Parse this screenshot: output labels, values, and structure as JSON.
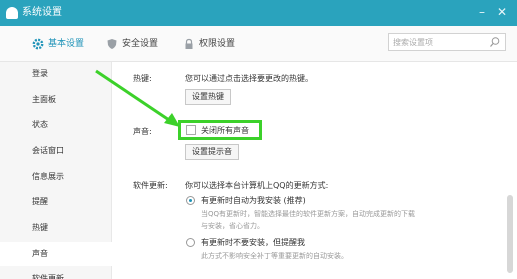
{
  "window": {
    "title": "系统设置",
    "minimize_glyph": "–",
    "close_glyph": "✕"
  },
  "tabs": [
    {
      "label": "基本设置",
      "icon": "gear-icon",
      "active": true
    },
    {
      "label": "安全设置",
      "icon": "shield-icon",
      "active": false
    },
    {
      "label": "权限设置",
      "icon": "lock-icon",
      "active": false
    }
  ],
  "search": {
    "placeholder": "搜索设置项"
  },
  "sidebar": {
    "items": [
      {
        "label": "登录"
      },
      {
        "label": "主面板"
      },
      {
        "label": "状态"
      },
      {
        "label": "会话窗口"
      },
      {
        "label": "信息展示"
      },
      {
        "label": "提醒"
      },
      {
        "label": "热键"
      },
      {
        "label": "声音",
        "active": true
      },
      {
        "label": "软件更新"
      }
    ]
  },
  "hotkey": {
    "label": "热键:",
    "desc": "您可以通过点击选择要更改的热键。",
    "button": "设置热键"
  },
  "sound": {
    "label": "声音:",
    "mute_all": "关闭所有声音",
    "mute_checked": false,
    "button": "设置提示音"
  },
  "update": {
    "label": "软件更新:",
    "desc": "你可以选择本台计算机上QQ的更新方式:",
    "options": [
      {
        "label": "有更新时自动为我安装 (推荐)",
        "selected": true,
        "note_line1": "当QQ有更新时，智能选择最佳的软件更新方案，自动完成更新的下载",
        "note_line2": "与安装，省心省力。"
      },
      {
        "label": "有更新时不要安装，但提醒我",
        "selected": false,
        "note_line1": "此方式不影响安全补丁等重要更新的自动安装。"
      }
    ]
  },
  "colors": {
    "titlebar": "#2aa3bd",
    "accent": "#1e93b8",
    "annotation": "#3cd12a"
  }
}
